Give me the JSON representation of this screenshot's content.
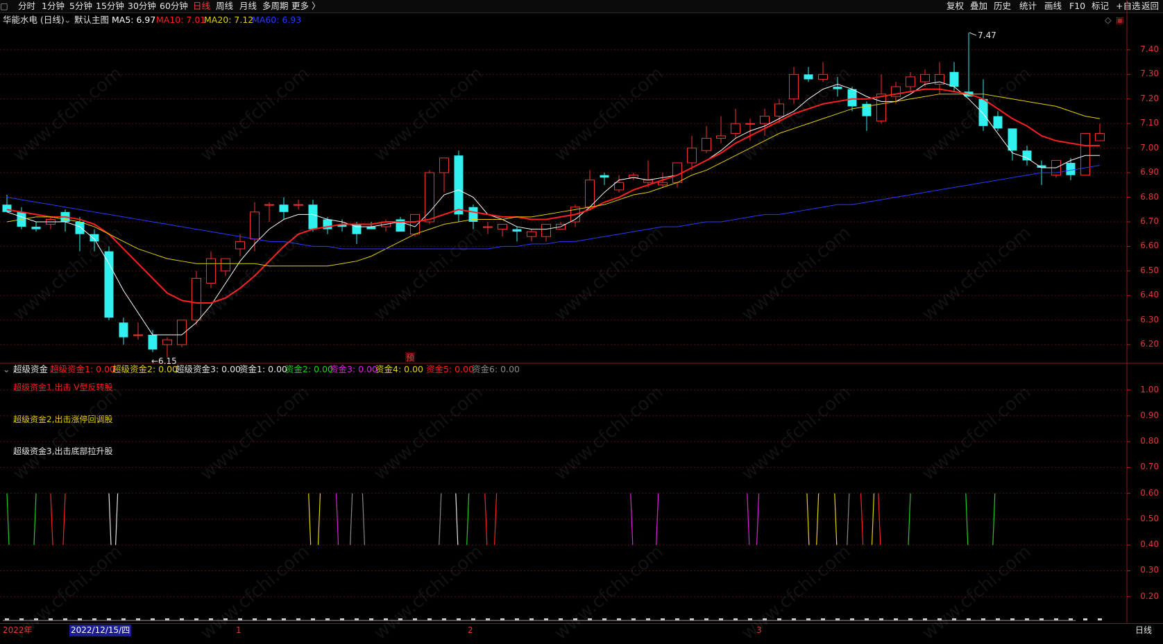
{
  "toolbar": {
    "left": [
      "分时",
      "1分钟",
      "5分钟",
      "15分钟",
      "30分钟",
      "60分钟",
      "日线",
      "周线",
      "月线",
      "多周期",
      "更多 〉"
    ],
    "active": "日线",
    "right": [
      "复权",
      "叠加",
      "历史",
      "统计",
      "画线",
      "F10",
      "标记",
      "+自选",
      "返回"
    ]
  },
  "main": {
    "stock": "华能水电 (日线)",
    "template": "默认主图",
    "ma": [
      {
        "label": "MA5: 6.97",
        "color": "#ffffff"
      },
      {
        "label": "MA10: 7.01",
        "color": "#ff2020"
      },
      {
        "label": "MA20: 7.12",
        "color": "#e6d200"
      },
      {
        "label": "MA60: 6.93",
        "color": "#2a3cff"
      }
    ],
    "high_label": "7.47",
    "low_label": "6.15",
    "marker": "预",
    "yticks": [
      "7.40",
      "7.30",
      "7.20",
      "7.10",
      "7.00",
      "6.90",
      "6.80",
      "6.70",
      "6.60",
      "6.50",
      "6.40",
      "6.30",
      "6.20"
    ]
  },
  "sub": {
    "name": "超级资金",
    "items": [
      {
        "label": "超级资金1: 0.00",
        "color": "#ff2020"
      },
      {
        "label": "超级资金2: 0.00",
        "color": "#e6d200"
      },
      {
        "label": "超级资金3: 0.00",
        "color": "#e6e6e6"
      },
      {
        "label": "资金1: 0.00",
        "color": "#e6e6e6"
      },
      {
        "label": "资金2: 0.00",
        "color": "#20d020"
      },
      {
        "label": "资金3: 0.00",
        "color": "#e020e0"
      },
      {
        "label": "资金4: 0.00",
        "color": "#e6d200"
      },
      {
        "label": "资金5: 0.00",
        "color": "#ff2020"
      },
      {
        "label": "资金6: 0.00",
        "color": "#8a8a8a"
      }
    ],
    "notes": [
      {
        "text": "超级资金1,出击 V型反转股",
        "color": "#ff2020"
      },
      {
        "text": "超级资金2,出击涨停回调股",
        "color": "#e6d200"
      },
      {
        "text": "超级资金3,出击底部拉升股",
        "color": "#e6e6e6"
      }
    ],
    "yticks": [
      "1.00",
      "0.90",
      "0.80",
      "0.70",
      "0.60",
      "0.50",
      "0.40",
      "0.30",
      "0.20"
    ]
  },
  "timebar": {
    "labels": [
      "2022年",
      "2022/12/15/四",
      "1",
      "2",
      "3"
    ],
    "period": "日线"
  },
  "watermark": "www.cfchi.com",
  "chart_data": {
    "type": "candlestick",
    "ylim": [
      6.13,
      7.49
    ],
    "sub_ylim": [
      0.1,
      1.05
    ],
    "ohlc": [
      [
        6.77,
        6.81,
        6.74,
        6.74
      ],
      [
        6.74,
        6.76,
        6.67,
        6.68
      ],
      [
        6.68,
        6.7,
        6.66,
        6.67
      ],
      [
        6.69,
        6.72,
        6.67,
        6.71
      ],
      [
        6.74,
        6.75,
        6.66,
        6.7
      ],
      [
        6.7,
        6.72,
        6.58,
        6.65
      ],
      [
        6.65,
        6.67,
        6.58,
        6.62
      ],
      [
        6.58,
        6.6,
        6.3,
        6.31
      ],
      [
        6.29,
        6.31,
        6.2,
        6.23
      ],
      [
        6.24,
        6.29,
        6.22,
        6.24
      ],
      [
        6.24,
        6.26,
        6.17,
        6.18
      ],
      [
        6.2,
        6.23,
        6.15,
        6.22
      ],
      [
        6.2,
        6.29,
        6.19,
        6.3
      ],
      [
        6.3,
        6.5,
        6.28,
        6.47
      ],
      [
        6.45,
        6.58,
        6.43,
        6.55
      ],
      [
        6.5,
        6.55,
        6.48,
        6.55
      ],
      [
        6.59,
        6.65,
        6.56,
        6.62
      ],
      [
        6.63,
        6.78,
        6.58,
        6.74
      ],
      [
        6.77,
        6.78,
        6.7,
        6.77
      ],
      [
        6.77,
        6.8,
        6.71,
        6.74
      ],
      [
        6.77,
        6.79,
        6.75,
        6.77
      ],
      [
        6.77,
        6.79,
        6.66,
        6.67
      ],
      [
        6.71,
        6.72,
        6.65,
        6.67
      ],
      [
        6.69,
        6.71,
        6.66,
        6.68
      ],
      [
        6.69,
        6.7,
        6.61,
        6.65
      ],
      [
        6.68,
        6.7,
        6.67,
        6.67
      ],
      [
        6.68,
        6.71,
        6.66,
        6.7
      ],
      [
        6.71,
        6.72,
        6.68,
        6.66
      ],
      [
        6.65,
        6.73,
        6.64,
        6.73
      ],
      [
        6.7,
        6.91,
        6.69,
        6.9
      ],
      [
        6.9,
        6.96,
        6.82,
        6.96
      ],
      [
        6.97,
        6.99,
        6.7,
        6.73
      ],
      [
        6.76,
        6.77,
        6.67,
        6.7
      ],
      [
        6.68,
        6.7,
        6.65,
        6.68
      ],
      [
        6.67,
        6.69,
        6.64,
        6.69
      ],
      [
        6.67,
        6.68,
        6.62,
        6.66
      ],
      [
        6.64,
        6.67,
        6.62,
        6.66
      ],
      [
        6.64,
        6.69,
        6.62,
        6.69
      ],
      [
        6.67,
        6.7,
        6.67,
        6.69
      ],
      [
        6.7,
        6.77,
        6.68,
        6.76
      ],
      [
        6.76,
        6.91,
        6.75,
        6.87
      ],
      [
        6.89,
        6.9,
        6.85,
        6.88
      ],
      [
        6.83,
        6.89,
        6.82,
        6.86
      ],
      [
        6.88,
        6.9,
        6.87,
        6.89
      ],
      [
        6.86,
        6.95,
        6.84,
        6.87
      ],
      [
        6.85,
        6.9,
        6.84,
        6.86
      ],
      [
        6.86,
        6.93,
        6.84,
        6.94
      ],
      [
        6.94,
        7.05,
        6.91,
        7.0
      ],
      [
        6.99,
        7.09,
        6.98,
        7.04
      ],
      [
        7.04,
        7.13,
        7.02,
        7.05
      ],
      [
        7.06,
        7.16,
        7.04,
        7.1
      ],
      [
        7.1,
        7.12,
        7.03,
        7.1
      ],
      [
        7.1,
        7.16,
        7.05,
        7.13
      ],
      [
        7.13,
        7.2,
        7.1,
        7.18
      ],
      [
        7.2,
        7.33,
        7.18,
        7.3
      ],
      [
        7.3,
        7.33,
        7.27,
        7.28
      ],
      [
        7.28,
        7.35,
        7.27,
        7.3
      ],
      [
        7.25,
        7.29,
        7.21,
        7.24
      ],
      [
        7.24,
        7.25,
        7.15,
        7.17
      ],
      [
        7.18,
        7.19,
        7.07,
        7.13
      ],
      [
        7.11,
        7.3,
        7.1,
        7.22
      ],
      [
        7.21,
        7.27,
        7.18,
        7.25
      ],
      [
        7.25,
        7.31,
        7.23,
        7.29
      ],
      [
        7.27,
        7.32,
        7.25,
        7.3
      ],
      [
        7.26,
        7.35,
        7.22,
        7.3
      ],
      [
        7.31,
        7.35,
        7.23,
        7.25
      ],
      [
        7.23,
        7.47,
        7.21,
        7.21
      ],
      [
        7.2,
        7.28,
        7.07,
        7.09
      ],
      [
        7.13,
        7.15,
        7.07,
        7.08
      ],
      [
        7.08,
        7.08,
        6.95,
        6.99
      ],
      [
        6.99,
        7.01,
        6.93,
        6.95
      ],
      [
        6.93,
        6.95,
        6.85,
        6.92
      ],
      [
        6.89,
        6.94,
        6.88,
        6.95
      ],
      [
        6.94,
        6.96,
        6.87,
        6.89
      ],
      [
        6.89,
        7.06,
        6.89,
        7.06
      ],
      [
        7.03,
        7.1,
        7.03,
        7.06
      ]
    ],
    "ma_series": {
      "MA5": [
        6.74,
        6.72,
        6.7,
        6.7,
        6.7,
        6.68,
        6.63,
        6.53,
        6.42,
        6.33,
        6.24,
        6.24,
        6.24,
        6.29,
        6.36,
        6.45,
        6.54,
        6.61,
        6.67,
        6.71,
        6.73,
        6.73,
        6.71,
        6.7,
        6.68,
        6.68,
        6.69,
        6.7,
        6.68,
        6.74,
        6.81,
        6.83,
        6.8,
        6.73,
        6.71,
        6.68,
        6.67,
        6.67,
        6.68,
        6.71,
        6.76,
        6.82,
        6.87,
        6.88,
        6.87,
        6.88,
        6.89,
        6.92,
        6.95,
        6.99,
        7.04,
        7.07,
        7.09,
        7.12,
        7.15,
        7.2,
        7.24,
        7.26,
        7.24,
        7.21,
        7.19,
        7.19,
        7.22,
        7.26,
        7.27,
        7.25,
        7.2,
        7.14,
        7.06,
        6.98,
        6.96,
        6.92,
        6.92,
        6.95,
        6.97,
        6.97
      ],
      "MA10": [
        6.75,
        6.74,
        6.73,
        6.72,
        6.72,
        6.71,
        6.69,
        6.65,
        6.59,
        6.53,
        6.47,
        6.41,
        6.38,
        6.37,
        6.37,
        6.39,
        6.43,
        6.48,
        6.54,
        6.6,
        6.65,
        6.67,
        6.68,
        6.69,
        6.69,
        6.69,
        6.7,
        6.7,
        6.7,
        6.71,
        6.73,
        6.75,
        6.74,
        6.73,
        6.72,
        6.72,
        6.71,
        6.71,
        6.72,
        6.73,
        6.75,
        6.78,
        6.8,
        6.83,
        6.85,
        6.87,
        6.89,
        6.92,
        6.95,
        6.98,
        7.02,
        7.05,
        7.08,
        7.11,
        7.14,
        7.16,
        7.18,
        7.19,
        7.2,
        7.2,
        7.21,
        7.22,
        7.23,
        7.24,
        7.24,
        7.23,
        7.22,
        7.2,
        7.16,
        7.12,
        7.09,
        7.05,
        7.03,
        7.02,
        7.01,
        7.01
      ],
      "MA20": [
        6.7,
        6.71,
        6.72,
        6.72,
        6.71,
        6.7,
        6.68,
        6.65,
        6.62,
        6.59,
        6.57,
        6.55,
        6.54,
        6.53,
        6.53,
        6.53,
        6.53,
        6.53,
        6.52,
        6.52,
        6.52,
        6.52,
        6.52,
        6.53,
        6.54,
        6.56,
        6.59,
        6.62,
        6.65,
        6.67,
        6.69,
        6.7,
        6.71,
        6.71,
        6.71,
        6.72,
        6.72,
        6.73,
        6.74,
        6.75,
        6.76,
        6.77,
        6.79,
        6.81,
        6.82,
        6.84,
        6.86,
        6.89,
        6.91,
        6.94,
        6.97,
        7.0,
        7.03,
        7.06,
        7.08,
        7.1,
        7.12,
        7.14,
        7.16,
        7.17,
        7.18,
        7.19,
        7.2,
        7.21,
        7.22,
        7.22,
        7.22,
        7.22,
        7.21,
        7.2,
        7.19,
        7.18,
        7.17,
        7.15,
        7.13,
        7.12
      ],
      "MA60": [
        6.8,
        6.79,
        6.78,
        6.77,
        6.76,
        6.75,
        6.74,
        6.73,
        6.72,
        6.71,
        6.7,
        6.69,
        6.68,
        6.67,
        6.66,
        6.65,
        6.64,
        6.63,
        6.62,
        6.62,
        6.61,
        6.6,
        6.6,
        6.59,
        6.59,
        6.59,
        6.59,
        6.59,
        6.59,
        6.59,
        6.59,
        6.59,
        6.59,
        6.59,
        6.6,
        6.6,
        6.61,
        6.61,
        6.62,
        6.62,
        6.63,
        6.64,
        6.65,
        6.66,
        6.67,
        6.68,
        6.68,
        6.69,
        6.7,
        6.7,
        6.71,
        6.72,
        6.73,
        6.73,
        6.74,
        6.75,
        6.76,
        6.77,
        6.77,
        6.78,
        6.79,
        6.8,
        6.81,
        6.82,
        6.83,
        6.84,
        6.85,
        6.86,
        6.87,
        6.88,
        6.89,
        6.9,
        6.9,
        6.91,
        6.92,
        6.93
      ]
    },
    "signals": [
      {
        "i": 0,
        "c": "#20d020"
      },
      {
        "i": 2,
        "c": "#20d020"
      },
      {
        "i": 3,
        "c": "#ff2020"
      },
      {
        "i": 4,
        "c": "#ff2020"
      },
      {
        "i": 7,
        "c": "#e6e6e6"
      },
      {
        "i": 7.6,
        "c": "#e6e6e6"
      },
      {
        "i": 20.7,
        "c": "#e6d200"
      },
      {
        "i": 21.5,
        "c": "#e6d200"
      },
      {
        "i": 22.6,
        "c": "#e020e0"
      },
      {
        "i": 23.7,
        "c": "#8a8a8a"
      },
      {
        "i": 24.4,
        "c": "#8a8a8a"
      },
      {
        "i": 29.8,
        "c": "#8a8a8a"
      },
      {
        "i": 30.8,
        "c": "#e6e6e6"
      },
      {
        "i": 31.7,
        "c": "#20d020"
      },
      {
        "i": 32.8,
        "c": "#ff2020"
      },
      {
        "i": 33.6,
        "c": "#ff2020"
      },
      {
        "i": 42.8,
        "c": "#e020e0"
      },
      {
        "i": 44.7,
        "c": "#e020e0"
      },
      {
        "i": 50.8,
        "c": "#e020e0"
      },
      {
        "i": 51.6,
        "c": "#e020e0"
      },
      {
        "i": 54.9,
        "c": "#e6d200"
      },
      {
        "i": 55.7,
        "c": "#e6d200"
      },
      {
        "i": 56.8,
        "c": "#e6d200"
      },
      {
        "i": 57.8,
        "c": "#8a8a8a"
      },
      {
        "i": 58.6,
        "c": "#ff2020"
      },
      {
        "i": 59.5,
        "c": "#e6d200"
      },
      {
        "i": 59.8,
        "c": "#ff2020"
      },
      {
        "i": 62.0,
        "c": "#20d020"
      },
      {
        "i": 65.8,
        "c": "#20d020"
      },
      {
        "i": 67.8,
        "c": "#20d020"
      }
    ]
  }
}
